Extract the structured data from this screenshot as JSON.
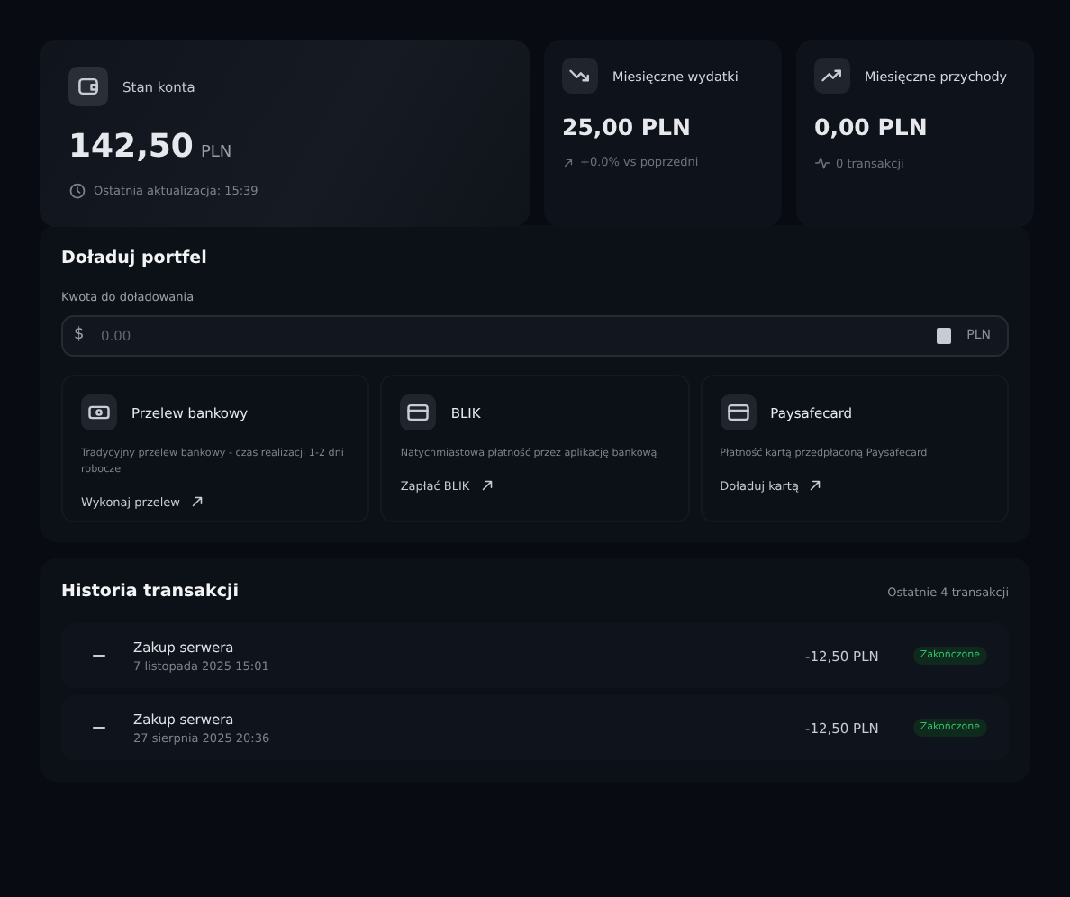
{
  "balance": {
    "label": "Stan konta",
    "amount": "142,50",
    "currency": "PLN",
    "updated": "Ostatnia aktualizacja: 15:39"
  },
  "stats": [
    {
      "kind": "down",
      "label": "Miesięczne wydatki",
      "amount": "25,00 PLN",
      "note": "+0.0% vs poprzedni"
    },
    {
      "kind": "up",
      "label": "Miesięczne przychody",
      "amount": "0,00 PLN",
      "note": "0 transakcji"
    }
  ],
  "topup": {
    "title": "Doładuj portfel",
    "field_label": "Kwota do doładowania",
    "currency_symbol": "$",
    "placeholder": "0.00",
    "currency": "PLN",
    "methods": [
      {
        "kind": "bank",
        "name": "Przelew bankowy",
        "description": "Tradycyjny przelew bankowy - czas realizacji 1-2 dni robocze",
        "action": "Wykonaj przelew"
      },
      {
        "kind": "card",
        "name": "BLIK",
        "description": "Natychmiastowa płatność przez aplikację bankową",
        "action": "Zapłać BLIK"
      },
      {
        "kind": "card",
        "name": "Paysafecard",
        "description": "Płatność kartą przedpłaconą Paysafecard",
        "action": "Doładuj kartą"
      }
    ]
  },
  "history": {
    "title": "Historia transakcji",
    "summary": "Ostatnie 4 transakcji",
    "rows": [
      {
        "title": "Zakup serwera",
        "date": "7 listopada 2025 15:01",
        "amount": "-12,50 PLN",
        "status": "Zakończone"
      },
      {
        "title": "Zakup serwera",
        "date": "27 sierpnia 2025 20:36",
        "amount": "-12,50 PLN",
        "status": "Zakończone"
      }
    ]
  }
}
